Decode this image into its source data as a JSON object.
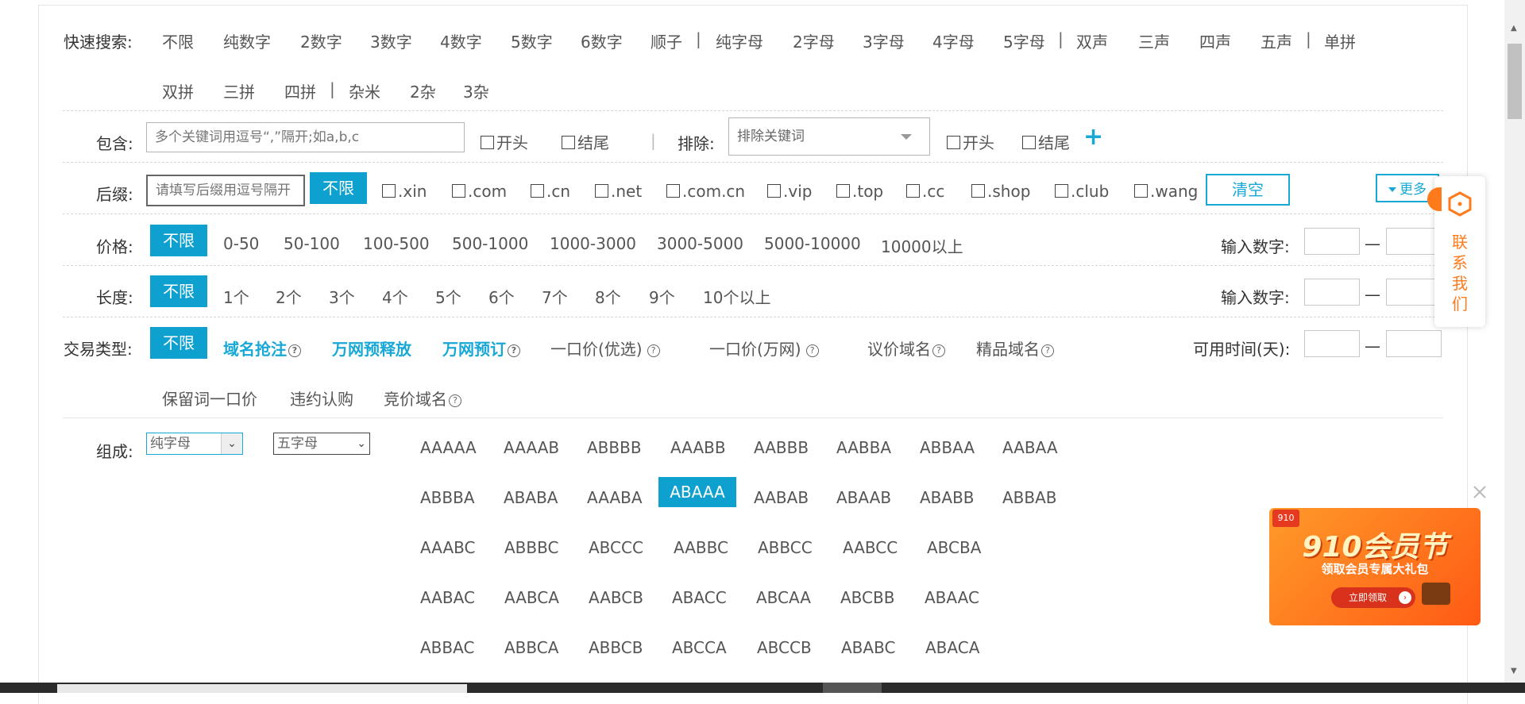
{
  "quick_search": {
    "label": "快速搜索:",
    "items": [
      "不限",
      "纯数字",
      "2数字",
      "3数字",
      "4数字",
      "5数字",
      "6数字",
      "顺子",
      "纯字母",
      "2字母",
      "3字母",
      "4字母",
      "5字母",
      "双声",
      "三声",
      "四声",
      "五声",
      "单拼",
      "双拼",
      "三拼",
      "四拼",
      "杂米",
      "2杂",
      "3杂"
    ]
  },
  "contains": {
    "label": "包含:",
    "placeholder": "多个关键词用逗号“,”隔开;如a,b,c",
    "start_label": "开头",
    "end_label": "结尾",
    "exclude_label": "排除:",
    "exclude_placeholder": "排除关键词",
    "exclude_start_label": "开头",
    "exclude_end_label": "结尾",
    "add_symbol": "+"
  },
  "suffix": {
    "label": "后缀:",
    "placeholder": "请填写后缀用逗号隔开",
    "any_label": "不限",
    "items": [
      ".xin",
      ".com",
      ".cn",
      ".net",
      ".com.cn",
      ".vip",
      ".top",
      ".cc",
      ".shop",
      ".club",
      ".wang"
    ],
    "clear_label": "清空",
    "more_label": "更多"
  },
  "price": {
    "label": "价格:",
    "any_label": "不限",
    "items": [
      "0-50",
      "50-100",
      "100-500",
      "500-1000",
      "1000-3000",
      "3000-5000",
      "5000-10000",
      "10000以上"
    ],
    "input_label": "输入数字:",
    "range_sep": "—"
  },
  "length": {
    "label": "长度:",
    "any_label": "不限",
    "items": [
      "1个",
      "2个",
      "3个",
      "4个",
      "5个",
      "6个",
      "7个",
      "8个",
      "9个",
      "10个以上"
    ],
    "input_label": "输入数字:",
    "range_sep": "—"
  },
  "trade_type": {
    "label": "交易类型:",
    "any_label": "不限",
    "highlight_items": [
      "域名抢注",
      "万网预释放",
      "万网预订"
    ],
    "items": [
      "一口价(优选)",
      "一口价(万网)",
      "议价域名",
      "精品域名"
    ],
    "items_row2": [
      "保留词一口价",
      "违约认购",
      "竞价域名"
    ],
    "available_label": "可用时间(天):",
    "range_sep": "—"
  },
  "composition": {
    "label": "组成:",
    "select1": "纯字母",
    "select2": "五字母",
    "patterns": [
      [
        "AAAAA",
        "AAAAB",
        "ABBBB",
        "AAABB",
        "AABBB",
        "AABBA",
        "ABBAA",
        "AABAA"
      ],
      [
        "ABBBA",
        "ABABA",
        "AAABA",
        "ABAAA",
        "AABAB",
        "ABAAB",
        "ABABB",
        "ABBAB"
      ],
      [
        "AAABC",
        "ABBBC",
        "ABCCC",
        "AABBC",
        "ABBCC",
        "AABCC",
        "ABCBA"
      ],
      [
        "AABAC",
        "AABCA",
        "AABCB",
        "ABACC",
        "ABCAA",
        "ABCBB",
        "ABAAC"
      ],
      [
        "ABBAC",
        "ABBCA",
        "ABBCB",
        "ABCCA",
        "ABCCB",
        "ABABC",
        "ABACA"
      ]
    ],
    "selected": "ABAAA"
  },
  "contact": {
    "chars": [
      "联",
      "系",
      "我",
      "们"
    ]
  },
  "ad": {
    "badge": "910",
    "title": "910会员节",
    "subtitle": "领取会员专属大礼包",
    "button": "立即领取"
  },
  "colors": {
    "accent": "#0ea1d0",
    "link": "#18a8d6",
    "orange": "#ff7a1a"
  }
}
